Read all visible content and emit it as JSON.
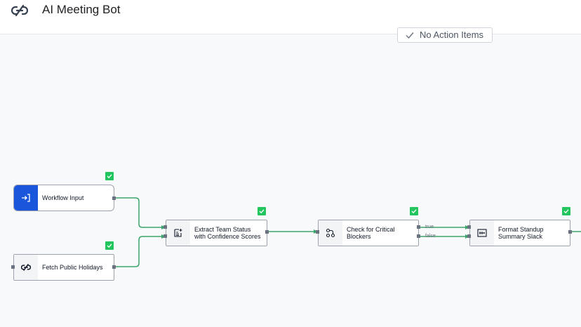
{
  "header": {
    "title": "AI Meeting Bot",
    "logo_icon": "link-icon"
  },
  "status_pill": {
    "label": "No Action Items",
    "icon": "check-icon"
  },
  "nodes": {
    "workflow_input": {
      "label": "Workflow Input",
      "icon": "enter-icon",
      "status": "success"
    },
    "fetch_holidays": {
      "label": "Fetch Public Holidays",
      "icon": "link-icon",
      "status": "success"
    },
    "extract_status": {
      "label_line1": "Extract Team Status",
      "label_line2": "with Confidence Scores",
      "icon": "document-sparkle-icon",
      "status": "success"
    },
    "check_blockers": {
      "label_line1": "Check for Critical",
      "label_line2": "Blockers",
      "icon": "branch-icon",
      "status": "success"
    },
    "format_summary": {
      "label_line1": "Format Standup",
      "label_line2": "Summary Slack",
      "icon": "format-icon",
      "status": "success"
    }
  },
  "edges": {
    "true_label": "true",
    "false_label": "false"
  },
  "colors": {
    "edge": "#3aa56b",
    "success": "#22c55e",
    "input_accent": "#1a56db"
  }
}
